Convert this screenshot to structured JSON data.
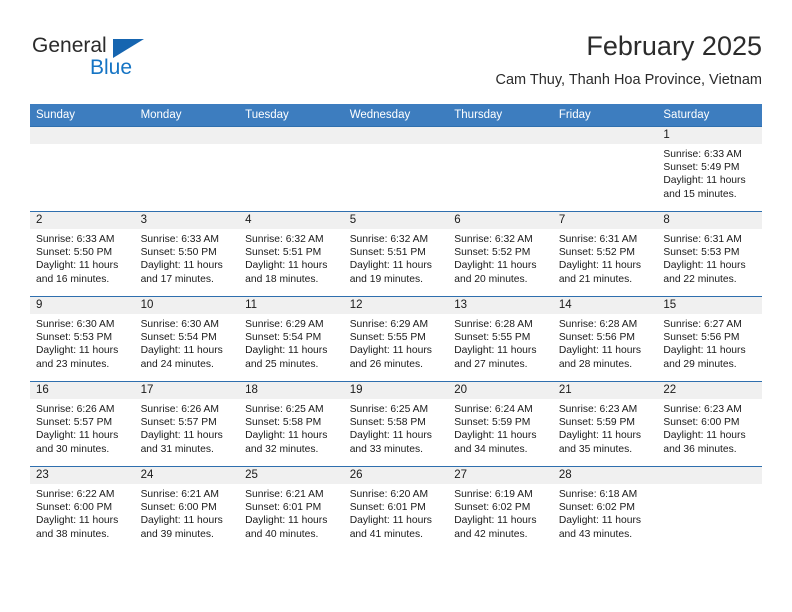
{
  "brand": {
    "line1": "General",
    "line2": "Blue",
    "triangle_color": "#1665b0",
    "line2_color": "#1574c4"
  },
  "header": {
    "title": "February 2025",
    "subtitle": "Cam Thuy, Thanh Hoa Province, Vietnam"
  },
  "theme": {
    "header_bg": "#3d7dbf",
    "row_divider": "#2f6fae",
    "daynum_bg": "#f0f0f0"
  },
  "weekdays": [
    "Sunday",
    "Monday",
    "Tuesday",
    "Wednesday",
    "Thursday",
    "Friday",
    "Saturday"
  ],
  "labels": {
    "sunrise": "Sunrise:",
    "sunset": "Sunset:",
    "daylight": "Daylight:"
  },
  "weeks": [
    [
      {
        "day": "",
        "sunrise": "",
        "sunset": "",
        "daylight": ""
      },
      {
        "day": "",
        "sunrise": "",
        "sunset": "",
        "daylight": ""
      },
      {
        "day": "",
        "sunrise": "",
        "sunset": "",
        "daylight": ""
      },
      {
        "day": "",
        "sunrise": "",
        "sunset": "",
        "daylight": ""
      },
      {
        "day": "",
        "sunrise": "",
        "sunset": "",
        "daylight": ""
      },
      {
        "day": "",
        "sunrise": "",
        "sunset": "",
        "daylight": ""
      },
      {
        "day": "1",
        "sunrise": "Sunrise: 6:33 AM",
        "sunset": "Sunset: 5:49 PM",
        "daylight": "Daylight: 11 hours and 15 minutes."
      }
    ],
    [
      {
        "day": "2",
        "sunrise": "Sunrise: 6:33 AM",
        "sunset": "Sunset: 5:50 PM",
        "daylight": "Daylight: 11 hours and 16 minutes."
      },
      {
        "day": "3",
        "sunrise": "Sunrise: 6:33 AM",
        "sunset": "Sunset: 5:50 PM",
        "daylight": "Daylight: 11 hours and 17 minutes."
      },
      {
        "day": "4",
        "sunrise": "Sunrise: 6:32 AM",
        "sunset": "Sunset: 5:51 PM",
        "daylight": "Daylight: 11 hours and 18 minutes."
      },
      {
        "day": "5",
        "sunrise": "Sunrise: 6:32 AM",
        "sunset": "Sunset: 5:51 PM",
        "daylight": "Daylight: 11 hours and 19 minutes."
      },
      {
        "day": "6",
        "sunrise": "Sunrise: 6:32 AM",
        "sunset": "Sunset: 5:52 PM",
        "daylight": "Daylight: 11 hours and 20 minutes."
      },
      {
        "day": "7",
        "sunrise": "Sunrise: 6:31 AM",
        "sunset": "Sunset: 5:52 PM",
        "daylight": "Daylight: 11 hours and 21 minutes."
      },
      {
        "day": "8",
        "sunrise": "Sunrise: 6:31 AM",
        "sunset": "Sunset: 5:53 PM",
        "daylight": "Daylight: 11 hours and 22 minutes."
      }
    ],
    [
      {
        "day": "9",
        "sunrise": "Sunrise: 6:30 AM",
        "sunset": "Sunset: 5:53 PM",
        "daylight": "Daylight: 11 hours and 23 minutes."
      },
      {
        "day": "10",
        "sunrise": "Sunrise: 6:30 AM",
        "sunset": "Sunset: 5:54 PM",
        "daylight": "Daylight: 11 hours and 24 minutes."
      },
      {
        "day": "11",
        "sunrise": "Sunrise: 6:29 AM",
        "sunset": "Sunset: 5:54 PM",
        "daylight": "Daylight: 11 hours and 25 minutes."
      },
      {
        "day": "12",
        "sunrise": "Sunrise: 6:29 AM",
        "sunset": "Sunset: 5:55 PM",
        "daylight": "Daylight: 11 hours and 26 minutes."
      },
      {
        "day": "13",
        "sunrise": "Sunrise: 6:28 AM",
        "sunset": "Sunset: 5:55 PM",
        "daylight": "Daylight: 11 hours and 27 minutes."
      },
      {
        "day": "14",
        "sunrise": "Sunrise: 6:28 AM",
        "sunset": "Sunset: 5:56 PM",
        "daylight": "Daylight: 11 hours and 28 minutes."
      },
      {
        "day": "15",
        "sunrise": "Sunrise: 6:27 AM",
        "sunset": "Sunset: 5:56 PM",
        "daylight": "Daylight: 11 hours and 29 minutes."
      }
    ],
    [
      {
        "day": "16",
        "sunrise": "Sunrise: 6:26 AM",
        "sunset": "Sunset: 5:57 PM",
        "daylight": "Daylight: 11 hours and 30 minutes."
      },
      {
        "day": "17",
        "sunrise": "Sunrise: 6:26 AM",
        "sunset": "Sunset: 5:57 PM",
        "daylight": "Daylight: 11 hours and 31 minutes."
      },
      {
        "day": "18",
        "sunrise": "Sunrise: 6:25 AM",
        "sunset": "Sunset: 5:58 PM",
        "daylight": "Daylight: 11 hours and 32 minutes."
      },
      {
        "day": "19",
        "sunrise": "Sunrise: 6:25 AM",
        "sunset": "Sunset: 5:58 PM",
        "daylight": "Daylight: 11 hours and 33 minutes."
      },
      {
        "day": "20",
        "sunrise": "Sunrise: 6:24 AM",
        "sunset": "Sunset: 5:59 PM",
        "daylight": "Daylight: 11 hours and 34 minutes."
      },
      {
        "day": "21",
        "sunrise": "Sunrise: 6:23 AM",
        "sunset": "Sunset: 5:59 PM",
        "daylight": "Daylight: 11 hours and 35 minutes."
      },
      {
        "day": "22",
        "sunrise": "Sunrise: 6:23 AM",
        "sunset": "Sunset: 6:00 PM",
        "daylight": "Daylight: 11 hours and 36 minutes."
      }
    ],
    [
      {
        "day": "23",
        "sunrise": "Sunrise: 6:22 AM",
        "sunset": "Sunset: 6:00 PM",
        "daylight": "Daylight: 11 hours and 38 minutes."
      },
      {
        "day": "24",
        "sunrise": "Sunrise: 6:21 AM",
        "sunset": "Sunset: 6:00 PM",
        "daylight": "Daylight: 11 hours and 39 minutes."
      },
      {
        "day": "25",
        "sunrise": "Sunrise: 6:21 AM",
        "sunset": "Sunset: 6:01 PM",
        "daylight": "Daylight: 11 hours and 40 minutes."
      },
      {
        "day": "26",
        "sunrise": "Sunrise: 6:20 AM",
        "sunset": "Sunset: 6:01 PM",
        "daylight": "Daylight: 11 hours and 41 minutes."
      },
      {
        "day": "27",
        "sunrise": "Sunrise: 6:19 AM",
        "sunset": "Sunset: 6:02 PM",
        "daylight": "Daylight: 11 hours and 42 minutes."
      },
      {
        "day": "28",
        "sunrise": "Sunrise: 6:18 AM",
        "sunset": "Sunset: 6:02 PM",
        "daylight": "Daylight: 11 hours and 43 minutes."
      },
      {
        "day": "",
        "sunrise": "",
        "sunset": "",
        "daylight": ""
      }
    ]
  ]
}
